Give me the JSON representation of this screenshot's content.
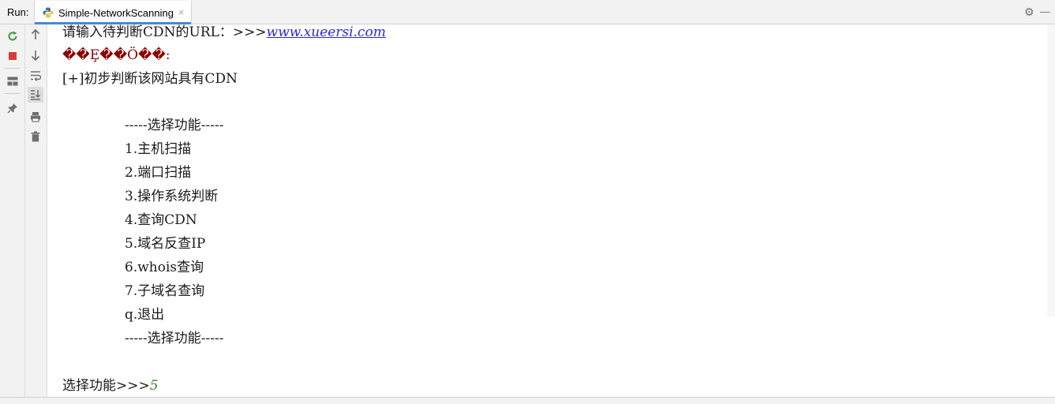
{
  "header": {
    "run_label": "Run:",
    "tab_title": "Simple-NetworkScanning",
    "tab_close": "×",
    "settings_icon": "⚙",
    "minimize_icon": "—"
  },
  "toolbar": {
    "items": [
      {
        "name": "rerun-icon"
      },
      {
        "name": "stop-icon"
      },
      {
        "name": "layout-icon"
      },
      {
        "name": "pin-icon"
      },
      {
        "name": "scroll-up-icon"
      },
      {
        "name": "scroll-down-icon"
      },
      {
        "name": "soft-wrap-icon"
      },
      {
        "name": "scroll-to-end-icon"
      },
      {
        "name": "print-icon"
      },
      {
        "name": "trash-icon"
      }
    ],
    "colors": {
      "rerun": "#3c9b3c",
      "stop": "#db3b3b",
      "icon": "#6e6e6e"
    }
  },
  "console": {
    "prompt_url": "请输入待判断CDN的URL：>>>",
    "url": "www.xueersi.com",
    "garbled_line": "��Ȩ��Ö��:",
    "cdn_result": "[+]初步判断该网站具有CDN",
    "menu_header": "-----选择功能-----",
    "menu_items": [
      "1.主机扫描",
      "2.端口扫描",
      "3.操作系统判断",
      "4.查询CDN",
      "5.域名反查IP",
      "6.whois查询",
      "7.子域名查询",
      "q.退出"
    ],
    "menu_footer": "-----选择功能-----",
    "select_prompt": "选择功能>>>",
    "select_input": "5"
  },
  "colors": {
    "link": "#2a2ad6",
    "garbled": "#8b0000",
    "user_input": "#2e8b2e"
  }
}
